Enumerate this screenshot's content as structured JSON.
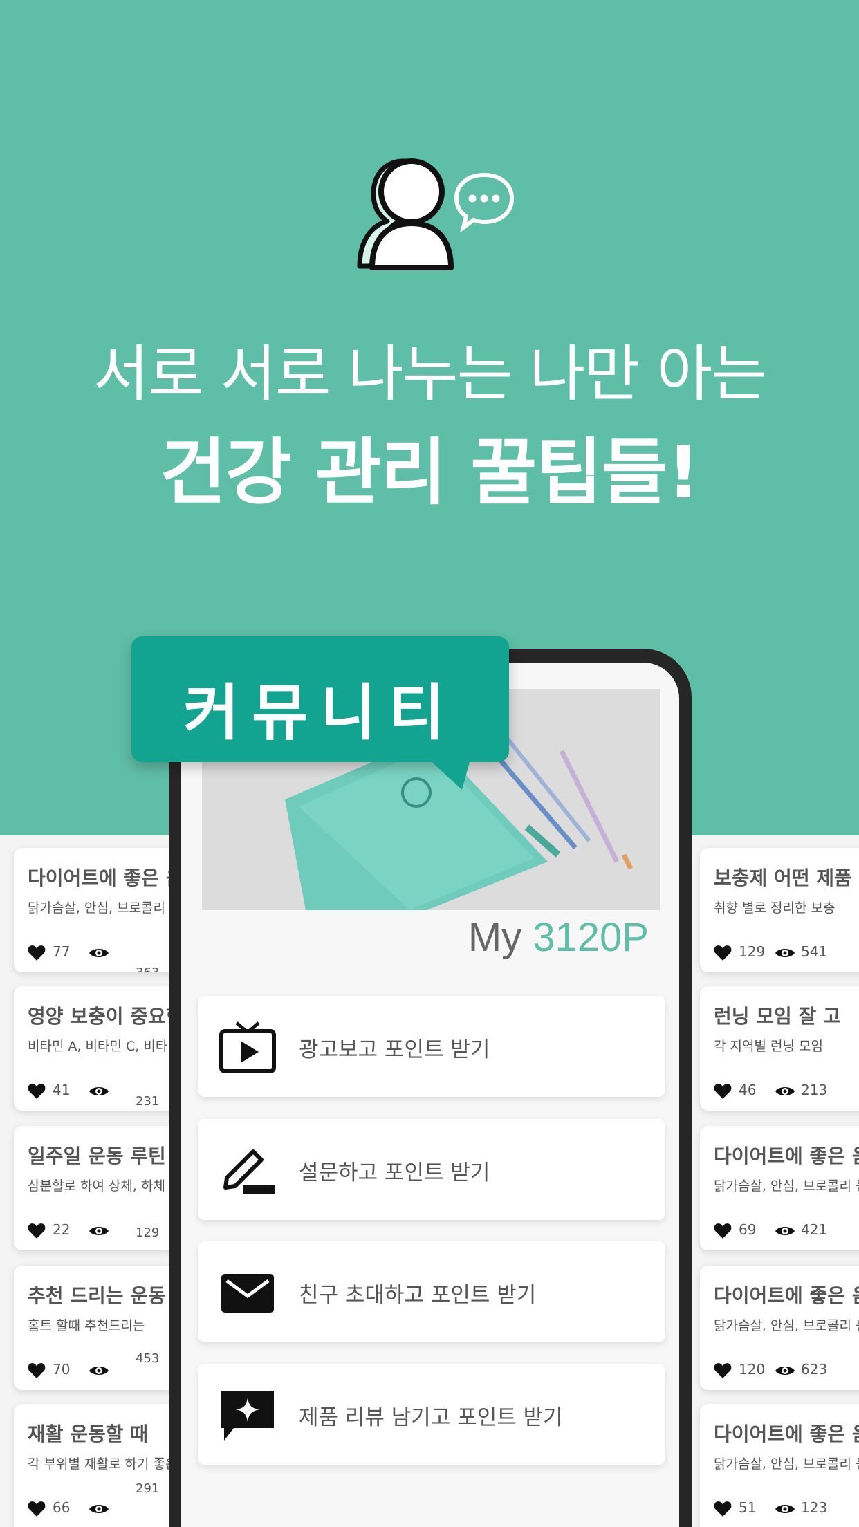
{
  "hero": {
    "icon": "community-people-chat-icon",
    "headline_line1": "서로 서로 나누는 나만 아는",
    "headline_line2": "건강 관리 꿀팁들!"
  },
  "tag": {
    "label": "커뮤니티"
  },
  "phone": {
    "points_prefix": "My",
    "points_value": "3120P",
    "menu": [
      {
        "icon": "tv-play-icon",
        "label": "광고보고 포인트 받기"
      },
      {
        "icon": "pencil-icon",
        "label": "설문하고 포인트 받기"
      },
      {
        "icon": "mail-icon",
        "label": "친구 초대하고 포인트 받기"
      },
      {
        "icon": "star-chat-icon",
        "label": "제품 리뷰 남기고 포인트 받기"
      }
    ]
  },
  "left_cards": [
    {
      "title": "다이어트에 좋은 음",
      "desc": "닭가슴살, 안심, 브로콜리 등",
      "likes": "77",
      "views": "363"
    },
    {
      "title": "영양 보충이 중요한",
      "desc": "비타민 A, 비타민 C, 비타민",
      "likes": "41",
      "views": "231"
    },
    {
      "title": "일주일 운동 루틴",
      "desc": "삼분할로 하여 상체, 하체",
      "likes": "22",
      "views": "129"
    },
    {
      "title": "추천 드리는 운동",
      "desc": "홈트 할때 추천드리는",
      "likes": "70",
      "views": "453"
    },
    {
      "title": "재활 운동할 때",
      "desc": "각 부위별 재활로 하기 좋은",
      "likes": "66",
      "views": "291"
    }
  ],
  "right_cards": [
    {
      "title": "보충제 어떤 제품",
      "desc": "취향 별로 정리한 보충",
      "likes": "129",
      "views": "541"
    },
    {
      "title": "런닝 모임 잘 고",
      "desc": "각 지역별 런닝 모임",
      "likes": "46",
      "views": "213"
    },
    {
      "title": "다이어트에 좋은 음",
      "desc": "닭가슴살, 안심, 브로콜리 등",
      "likes": "69",
      "views": "421"
    },
    {
      "title": "다이어트에 좋은 음",
      "desc": "닭가슴살, 안심, 브로콜리 등",
      "likes": "120",
      "views": "623"
    },
    {
      "title": "다이어트에 좋은 음",
      "desc": "닭가슴살, 안심, 브로콜리 등",
      "likes": "51",
      "views": "123"
    }
  ],
  "colors": {
    "brand_green": "#5fbea7",
    "tag_green": "#12a391",
    "text_gray": "#555555"
  }
}
